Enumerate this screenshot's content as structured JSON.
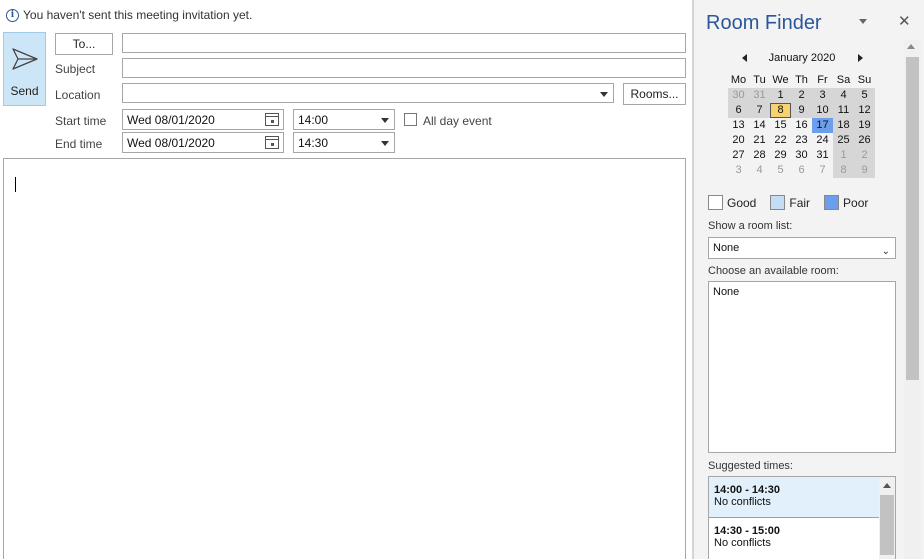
{
  "info_bar": {
    "message": "You haven't sent this meeting invitation yet."
  },
  "send": {
    "label": "Send"
  },
  "form": {
    "to_label": "To...",
    "to_value": "",
    "subject_label": "Subject",
    "subject_value": "",
    "location_label": "Location",
    "location_value": "",
    "rooms_label": "Rooms...",
    "start_label": "Start time",
    "start_date": "Wed 08/01/2020",
    "start_time": "14:00",
    "end_label": "End time",
    "end_date": "Wed 08/01/2020",
    "end_time": "14:30",
    "all_day_label": "All day event",
    "all_day_checked": false
  },
  "room_finder": {
    "title": "Room Finder",
    "calendar": {
      "month_label": "January 2020",
      "weekdays": [
        "Mo",
        "Tu",
        "We",
        "Th",
        "Fr",
        "Sa",
        "Su"
      ],
      "weeks": [
        [
          "30",
          "31",
          "1",
          "2",
          "3",
          "4",
          "5"
        ],
        [
          "6",
          "7",
          "8",
          "9",
          "10",
          "11",
          "12"
        ],
        [
          "13",
          "14",
          "15",
          "16",
          "17",
          "18",
          "19"
        ],
        [
          "20",
          "21",
          "22",
          "23",
          "24",
          "25",
          "26"
        ],
        [
          "27",
          "28",
          "29",
          "30",
          "31",
          "1",
          "2"
        ],
        [
          "3",
          "4",
          "5",
          "6",
          "7",
          "8",
          "9"
        ]
      ],
      "today": "8",
      "selected": "17"
    },
    "legend": [
      {
        "label": "Good",
        "color": "#ffffff"
      },
      {
        "label": "Fair",
        "color": "#c6dcf5"
      },
      {
        "label": "Poor",
        "color": "#6d9eeb"
      }
    ],
    "room_list_label": "Show a room list:",
    "room_list_value": "None",
    "available_label": "Choose an available room:",
    "available_value": "None",
    "suggested_label": "Suggested times:",
    "suggested": [
      {
        "time": "14:00 - 14:30",
        "status": "No conflicts"
      },
      {
        "time": "14:30 - 15:00",
        "status": "No conflicts"
      }
    ]
  }
}
